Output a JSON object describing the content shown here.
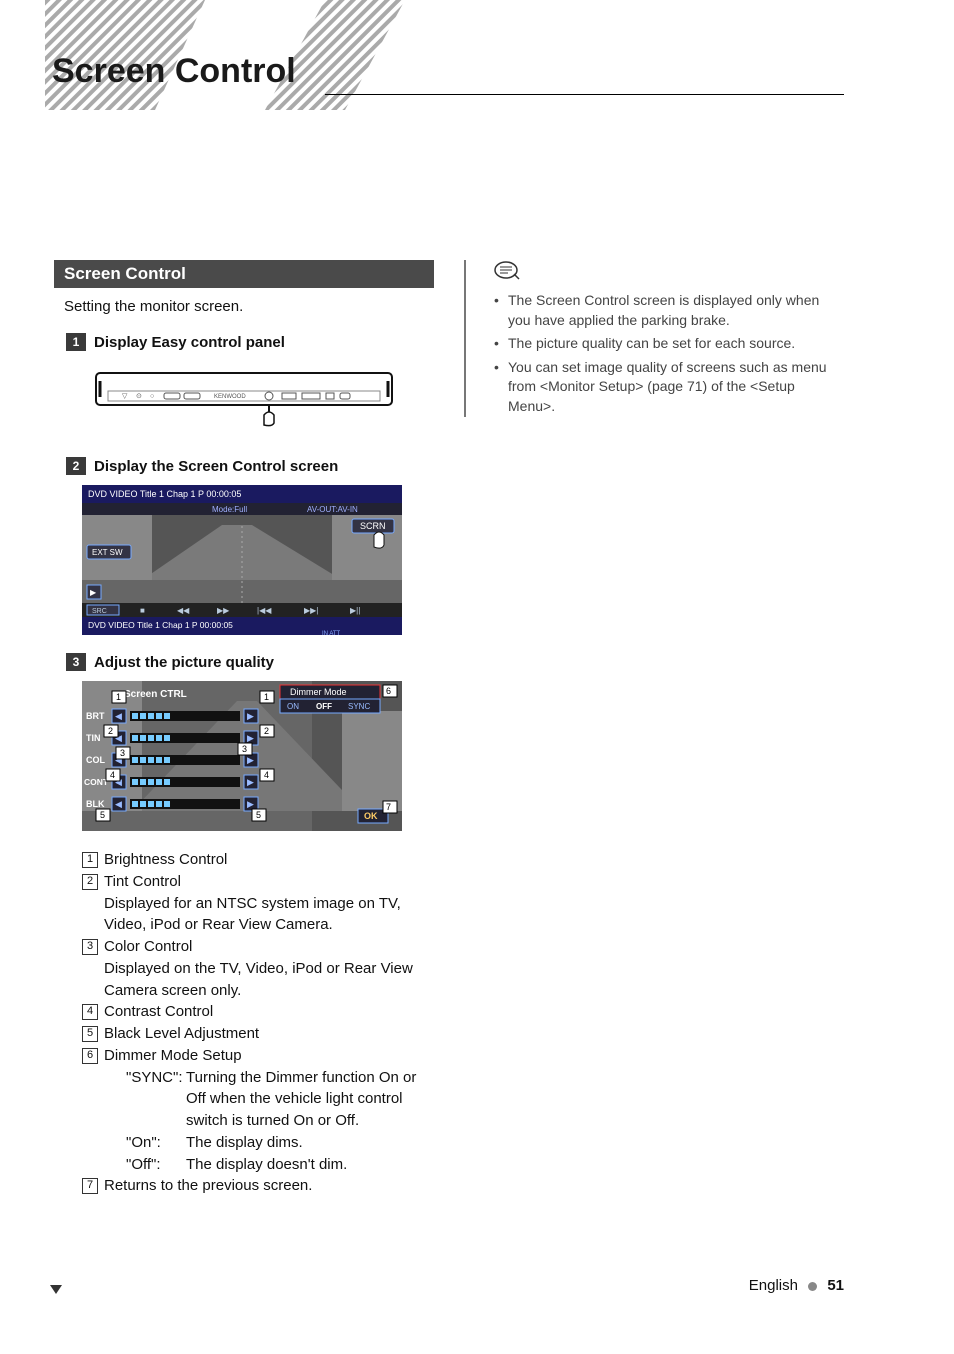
{
  "page_title": "Screen Control",
  "section_bar": "Screen Control",
  "intro": "Setting the monitor screen.",
  "steps": [
    {
      "n": "1",
      "label": "Display Easy control panel"
    },
    {
      "n": "2",
      "label": "Display the Screen Control screen"
    },
    {
      "n": "3",
      "label": "Adjust the picture quality"
    }
  ],
  "screen2": {
    "top_line": "DVD VIDEO   Title   1    Chap    1    P  00:00:05",
    "sub_line1": "Mode:Full",
    "sub_line2": "AV-OUT:AV-IN",
    "scrn": "SCRN",
    "ext": "EXT SW",
    "src": "SRC",
    "bottom_line": "DVD VIDEO    Title    1     Chap     1      P   00:00:05",
    "transport": [
      "■",
      "◀◀",
      "▶▶",
      "|◀◀",
      "▶▶|",
      "▶||"
    ],
    "in_att": "IN    ATT"
  },
  "screen3": {
    "title": "Screen CTRL",
    "dimmer_label": "Dimmer   Mode",
    "dimmer_opts": [
      "ON",
      "OFF",
      "SYNC"
    ],
    "rows": [
      "BRT",
      "TIN",
      "COL",
      "CONT",
      "BLK"
    ],
    "ok": "OK",
    "callouts": [
      "1",
      "2",
      "3",
      "4",
      "5",
      "6",
      "7"
    ]
  },
  "list": [
    {
      "n": "1",
      "title": "Brightness Control"
    },
    {
      "n": "2",
      "title": "Tint Control",
      "desc": "Displayed for an NTSC system image on TV, Video, iPod or Rear View Camera."
    },
    {
      "n": "3",
      "title": "Color Control",
      "desc": "Displayed on the TV, Video, iPod or Rear View Camera screen only."
    },
    {
      "n": "4",
      "title": "Contrast Control"
    },
    {
      "n": "5",
      "title": "Black Level Adjustment"
    },
    {
      "n": "6",
      "title": "Dimmer Mode Setup",
      "modes": [
        {
          "k": "\"SYNC\":",
          "v": "Turning the Dimmer function On or Off when the vehicle light control switch is turned On or Off."
        },
        {
          "k": "\"On\":",
          "v": "The display dims."
        },
        {
          "k": "\"Off\":",
          "v": "The display doesn't dim."
        }
      ]
    },
    {
      "n": "7",
      "title": "Returns to the previous screen."
    }
  ],
  "notes": [
    "The Screen Control screen is displayed only when you have applied the parking brake.",
    "The picture quality can be set for each source.",
    "You can set image quality of screens such as menu from <Monitor Setup> (page 71) of the <Setup Menu>."
  ],
  "footer": {
    "lang": "English",
    "page": "51"
  }
}
